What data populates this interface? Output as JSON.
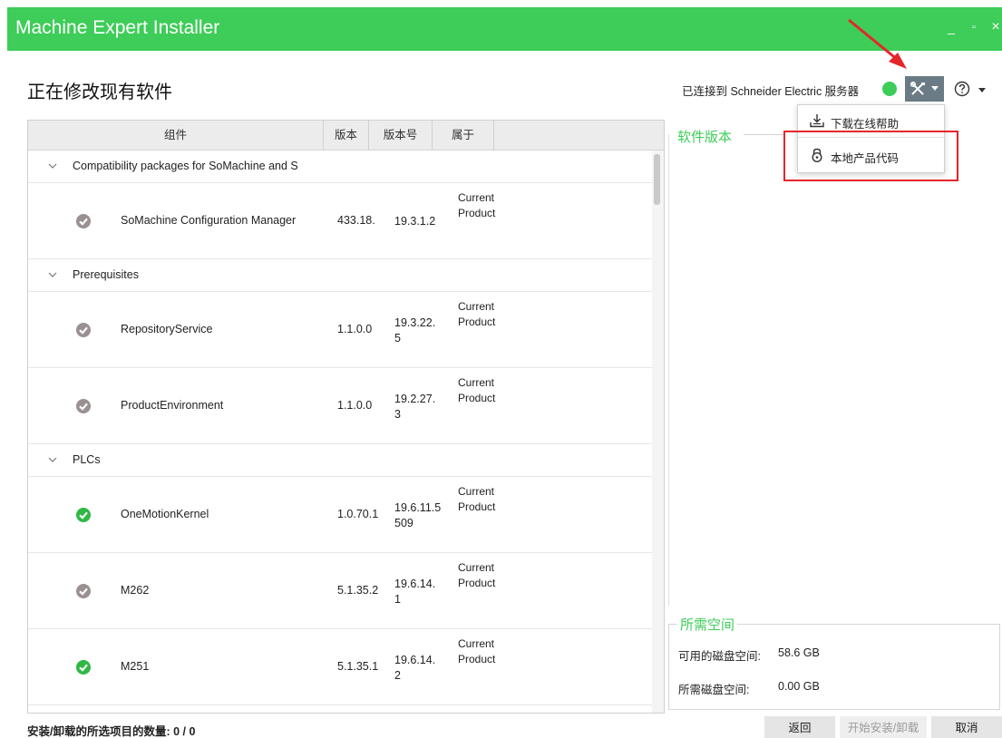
{
  "window": {
    "title": "Machine Expert Installer",
    "controls": {
      "minimize": "_",
      "maximize": "▫",
      "close": "×"
    }
  },
  "header": {
    "page_title": "正在修改现有软件",
    "connection_text": "已连接到 Schneider Electric 服务器",
    "connection_status_color": "#3dcd58",
    "tools_icon": "tools-icon",
    "help_icon": "help-icon"
  },
  "tools_menu": {
    "items": [
      {
        "label": "下载在线帮助",
        "icon": "download-icon"
      },
      {
        "label": "本地产品代码",
        "icon": "lock-icon"
      }
    ]
  },
  "table": {
    "columns": [
      "组件",
      "版本",
      "版本号",
      "属于"
    ],
    "groups": [
      {
        "label": "Compatibility packages for SoMachine and S",
        "items": [
          {
            "name": "SoMachine Configuration Manager",
            "version": "433.18.",
            "build": "19.3.1.2",
            "belongs": "Current Product",
            "status": "grey"
          }
        ]
      },
      {
        "label": "Prerequisites",
        "items": [
          {
            "name": "RepositoryService",
            "version": "1.1.0.0",
            "build": "19.3.22.5",
            "belongs": "Current Product",
            "status": "grey"
          },
          {
            "name": "ProductEnvironment",
            "version": "1.1.0.0",
            "build": "19.2.27.3",
            "belongs": "Current Product",
            "status": "grey"
          }
        ]
      },
      {
        "label": "PLCs",
        "items": [
          {
            "name": "OneMotionKernel",
            "version": "1.0.70.1",
            "build": "19.6.11.5509",
            "belongs": "Current Product",
            "status": "green"
          },
          {
            "name": "M262",
            "version": "5.1.35.2",
            "build": "19.6.14.1",
            "belongs": "Current Product",
            "status": "grey"
          },
          {
            "name": "M251",
            "version": "5.1.35.1",
            "build": "19.6.14.2",
            "belongs": "Current Product",
            "status": "green"
          }
        ]
      }
    ]
  },
  "version_panel": {
    "title": "软件版本"
  },
  "space_panel": {
    "title": "所需空间",
    "available_label": "可用的磁盘空间:",
    "available_value": "58.6 GB",
    "required_label": "所需磁盘空间:",
    "required_value": "0.00 GB"
  },
  "footer": {
    "selection_label": "安装/卸载的所选项目的数量:",
    "selection_value": "0 / 0",
    "back_label": "返回",
    "start_label": "开始安装/卸载",
    "cancel_label": "取消"
  },
  "colors": {
    "brand_green": "#3dcd58",
    "annotation_red": "#e5262b",
    "status_grey": "#9b9091",
    "status_green": "#2fb844"
  }
}
